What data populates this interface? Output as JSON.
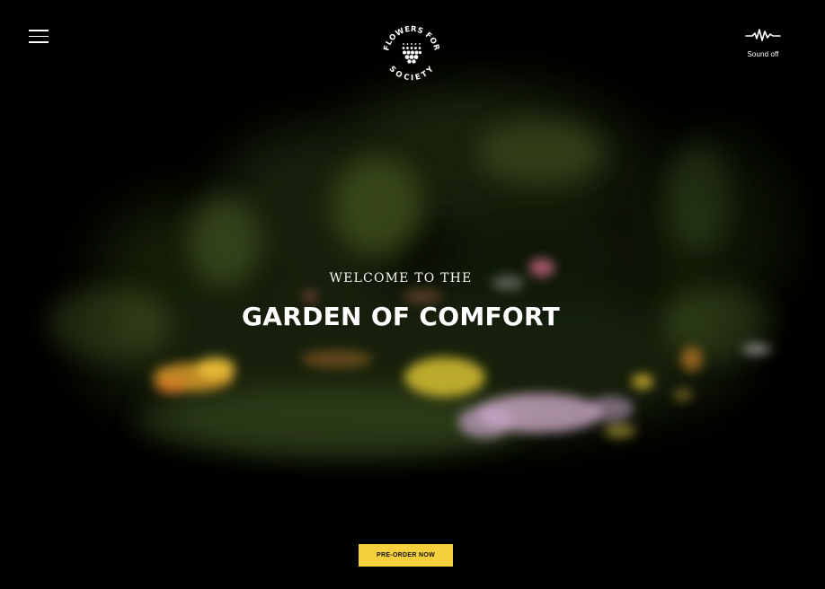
{
  "header": {
    "menu_icon": "hamburger-menu-icon",
    "logo": {
      "arc_top": "FLOWERS FOR",
      "arc_bottom": "SOCIETY",
      "mark_icon": "flower-dots-icon"
    },
    "sound": {
      "icon": "sound-wave-icon",
      "label": "Sound off"
    }
  },
  "hero": {
    "kicker": "WELCOME TO THE",
    "title": "GARDEN OF COMFORT",
    "cta_label": "PRE-ORDER NOW"
  },
  "colors": {
    "background": "#000000",
    "accent": "#f6cf3c",
    "text": "#ffffff"
  }
}
